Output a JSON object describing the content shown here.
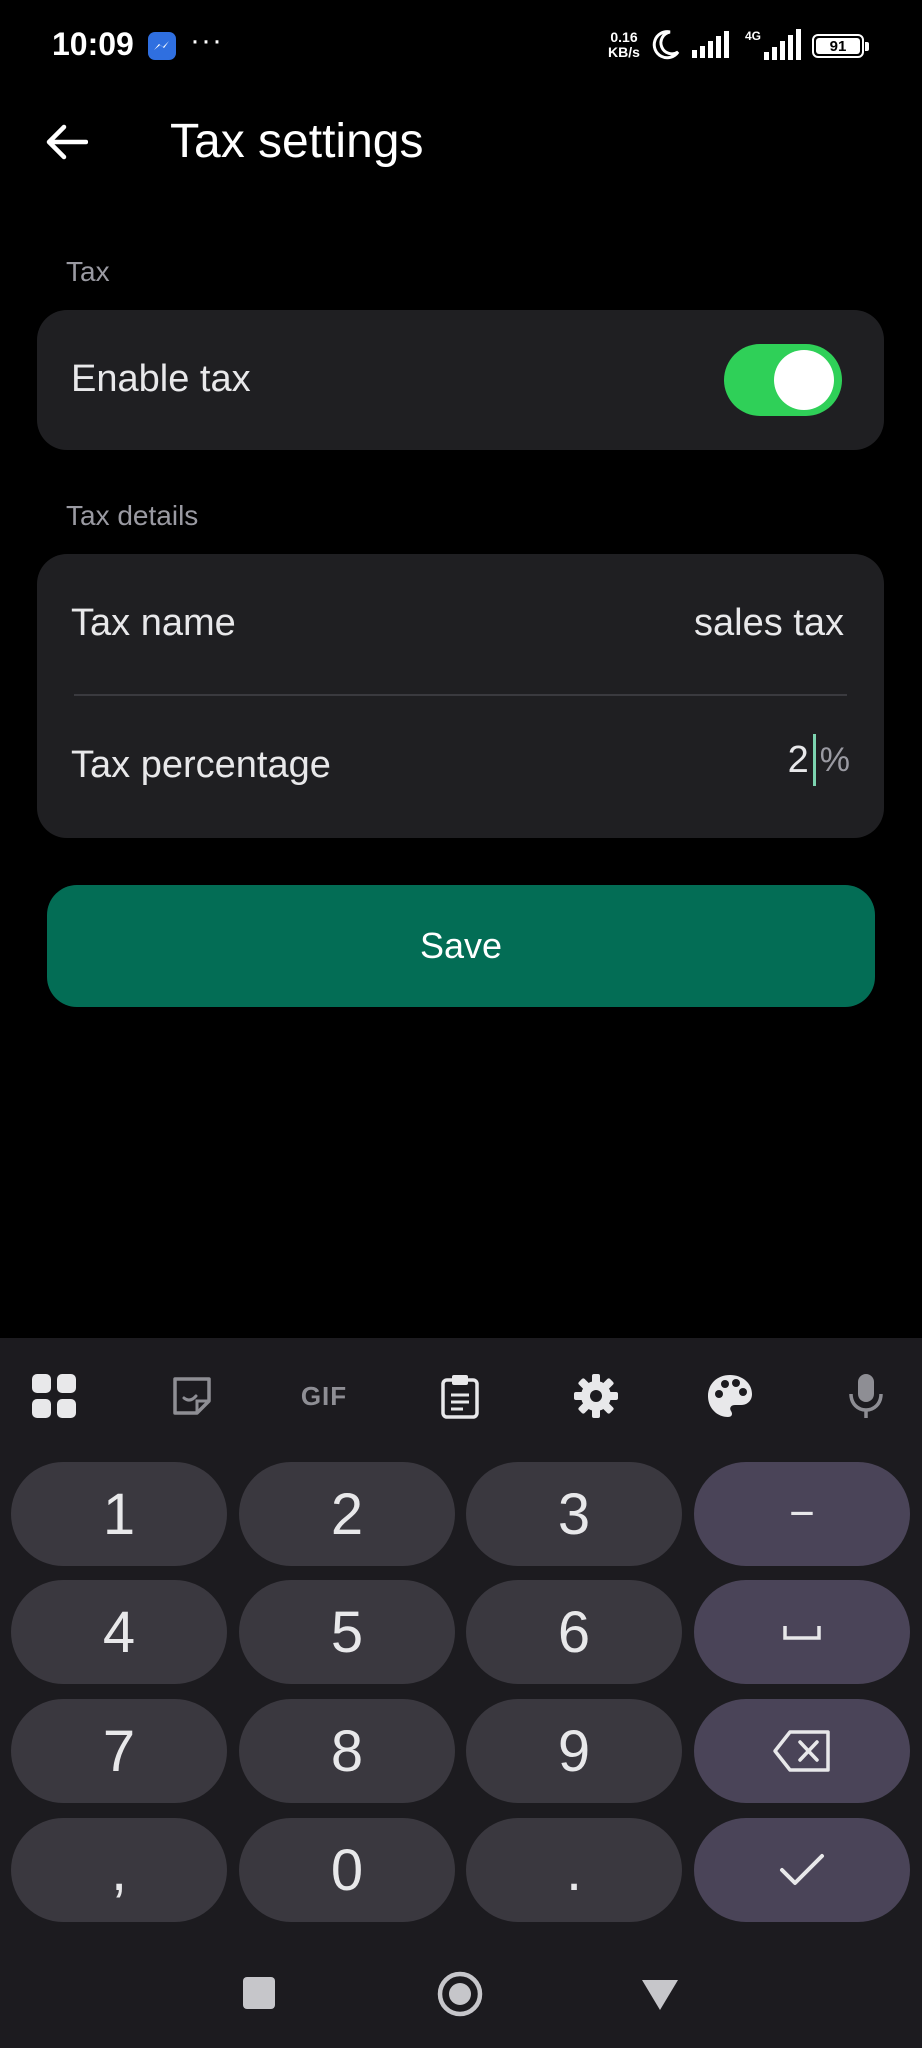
{
  "status_bar": {
    "time": "10:09",
    "dots": "···",
    "speed": "0.16",
    "speed_unit": "KB/s",
    "network": "4G",
    "battery": "91",
    "icons": [
      "messenger-icon",
      "moon-icon",
      "signal-icon",
      "battery-icon"
    ]
  },
  "header": {
    "title": "Tax settings",
    "back_icon": "arrow-left-icon"
  },
  "tax_section": {
    "label": "Tax",
    "enable_label": "Enable tax",
    "enabled": true
  },
  "details_section": {
    "label": "Tax details",
    "name_label": "Tax name",
    "name_value": "sales tax",
    "percentage_label": "Tax percentage",
    "percentage_value": "2",
    "percentage_suffix": "%"
  },
  "save_label": "Save",
  "colors": {
    "accent": "#036d55",
    "toggle_on": "#2fd058",
    "card": "#1f1f22",
    "key": "#3a383f",
    "key_fn": "#4a4458"
  },
  "keyboard": {
    "toolbar": [
      "apps-grid-icon",
      "sticker-icon",
      "gif-icon",
      "clipboard-icon",
      "gear-icon",
      "palette-icon",
      "microphone-icon"
    ],
    "gif_label": "GIF",
    "keys": [
      [
        "1",
        "2",
        "3",
        "−"
      ],
      [
        "4",
        "5",
        "6",
        "␣"
      ],
      [
        "7",
        "8",
        "9",
        "⌫"
      ],
      [
        ",",
        "0",
        ".",
        "✓"
      ]
    ]
  },
  "nav_bar": [
    "recent-apps-icon",
    "home-icon",
    "back-icon"
  ]
}
